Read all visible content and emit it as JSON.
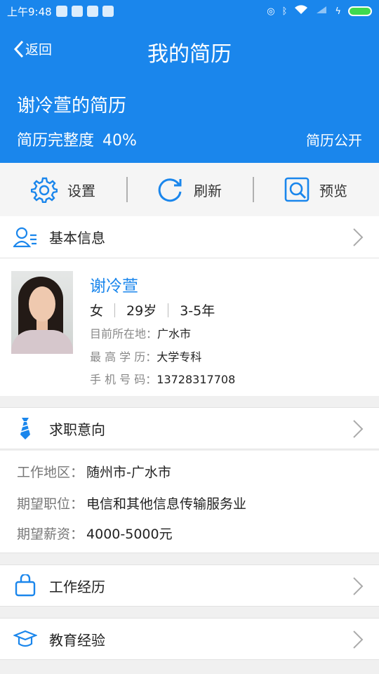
{
  "status_bar": {
    "time": "上午9:48"
  },
  "header": {
    "back_label": "返回",
    "title": "我的简历",
    "resume_owner": "谢冷萱的简历",
    "completeness_label": "简历完整度",
    "completeness_value": "40%",
    "public_label": "简历公开"
  },
  "actions": [
    {
      "label": "设置",
      "icon": "gear-icon"
    },
    {
      "label": "刷新",
      "icon": "refresh-icon"
    },
    {
      "label": "预览",
      "icon": "preview-icon"
    }
  ],
  "basic_info": {
    "section_title": "基本信息",
    "name": "谢冷萱",
    "gender": "女",
    "age": "29岁",
    "experience": "3-5年",
    "location_label": "目前所在地：",
    "location": "广水市",
    "education_label": "最 高 学 历：",
    "education": "大学专科",
    "phone_label": "手 机 号 码：",
    "phone": "13728317708"
  },
  "job_intention": {
    "section_title": "求职意向",
    "area_label": "工作地区：",
    "area": "随州市-广水市",
    "position_label": "期望职位：",
    "position": "电信和其他信息传输服务业",
    "salary_label": "期望薪资：",
    "salary": "4000-5000元"
  },
  "work_experience": {
    "section_title": "工作经历"
  },
  "education_experience": {
    "section_title": "教育经验"
  },
  "colors": {
    "primary": "#1a86ec",
    "battery": "#3fd94f"
  }
}
